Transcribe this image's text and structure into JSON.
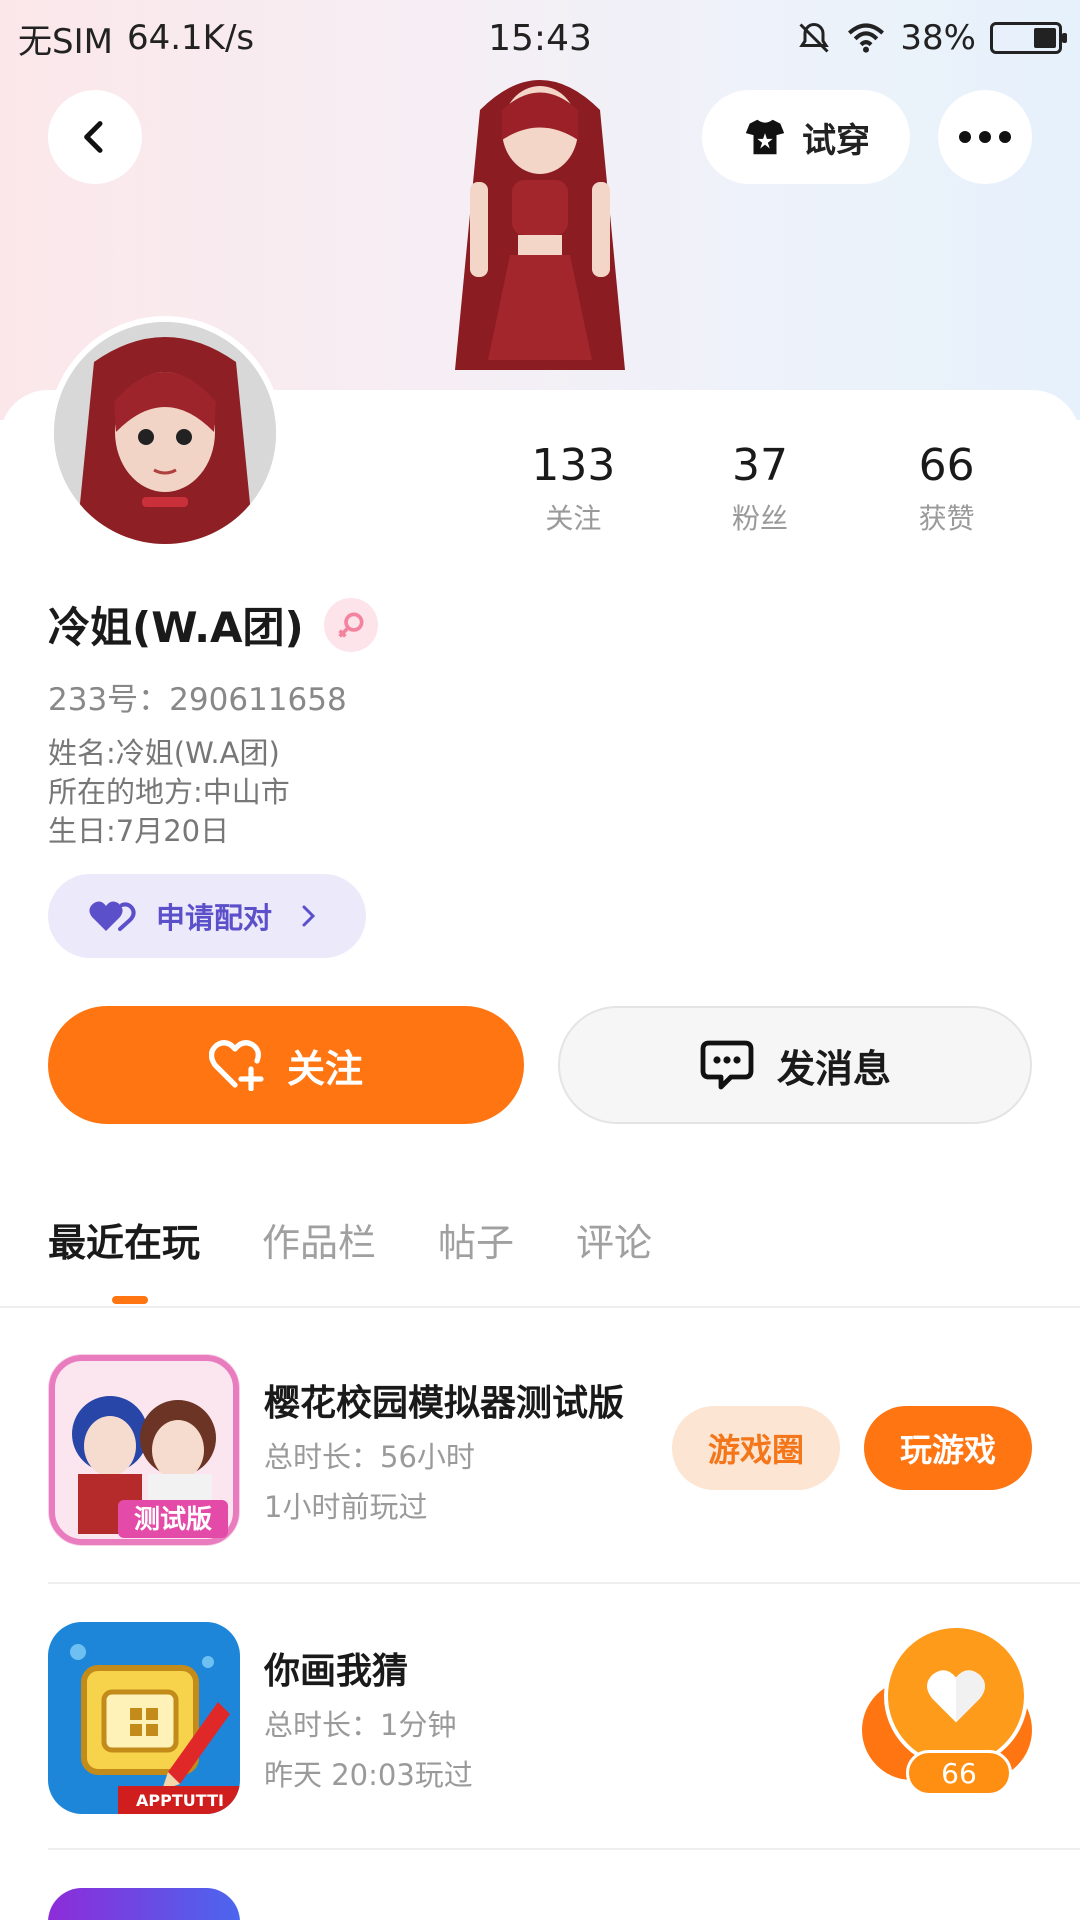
{
  "status_bar": {
    "carrier": "无SIM",
    "speed": "64.1K/s",
    "time": "15:43",
    "battery": "38%"
  },
  "header": {
    "back_icon": "chevron-left-icon",
    "tryon_label": "试穿",
    "more_icon": "more-dots-icon"
  },
  "profile": {
    "stats": [
      {
        "value": "133",
        "label": "关注"
      },
      {
        "value": "37",
        "label": "粉丝"
      },
      {
        "value": "66",
        "label": "获赞"
      }
    ],
    "name": "冷姐(W.A团)",
    "gender_icon": "female-icon",
    "uid": "233号：290611658",
    "info": [
      "姓名:冷姐(W.A团)",
      "所在的地方:中山市",
      "生日:7月20日"
    ],
    "pair_label": "申请配对"
  },
  "actions": {
    "follow_label": "关注",
    "message_label": "发消息"
  },
  "tabs": [
    "最近在玩",
    "作品栏",
    "帖子",
    "评论"
  ],
  "games": [
    {
      "title": "樱花校园模拟器测试版",
      "duration": "总时长：56小时",
      "last_played": "1小时前玩过",
      "icon_badge": "测试版",
      "circle_label": "游戏圈",
      "play_label": "玩游戏"
    },
    {
      "title": "你画我猜",
      "duration": "总时长：1分钟",
      "last_played": "昨天 20:03玩过",
      "icon_badge": "APPTUTTI"
    }
  ],
  "like_widget": {
    "count": "66"
  },
  "colors": {
    "accent": "#ff7512",
    "pair_bg": "#ece9fb",
    "pair_text": "#5b50c9"
  }
}
